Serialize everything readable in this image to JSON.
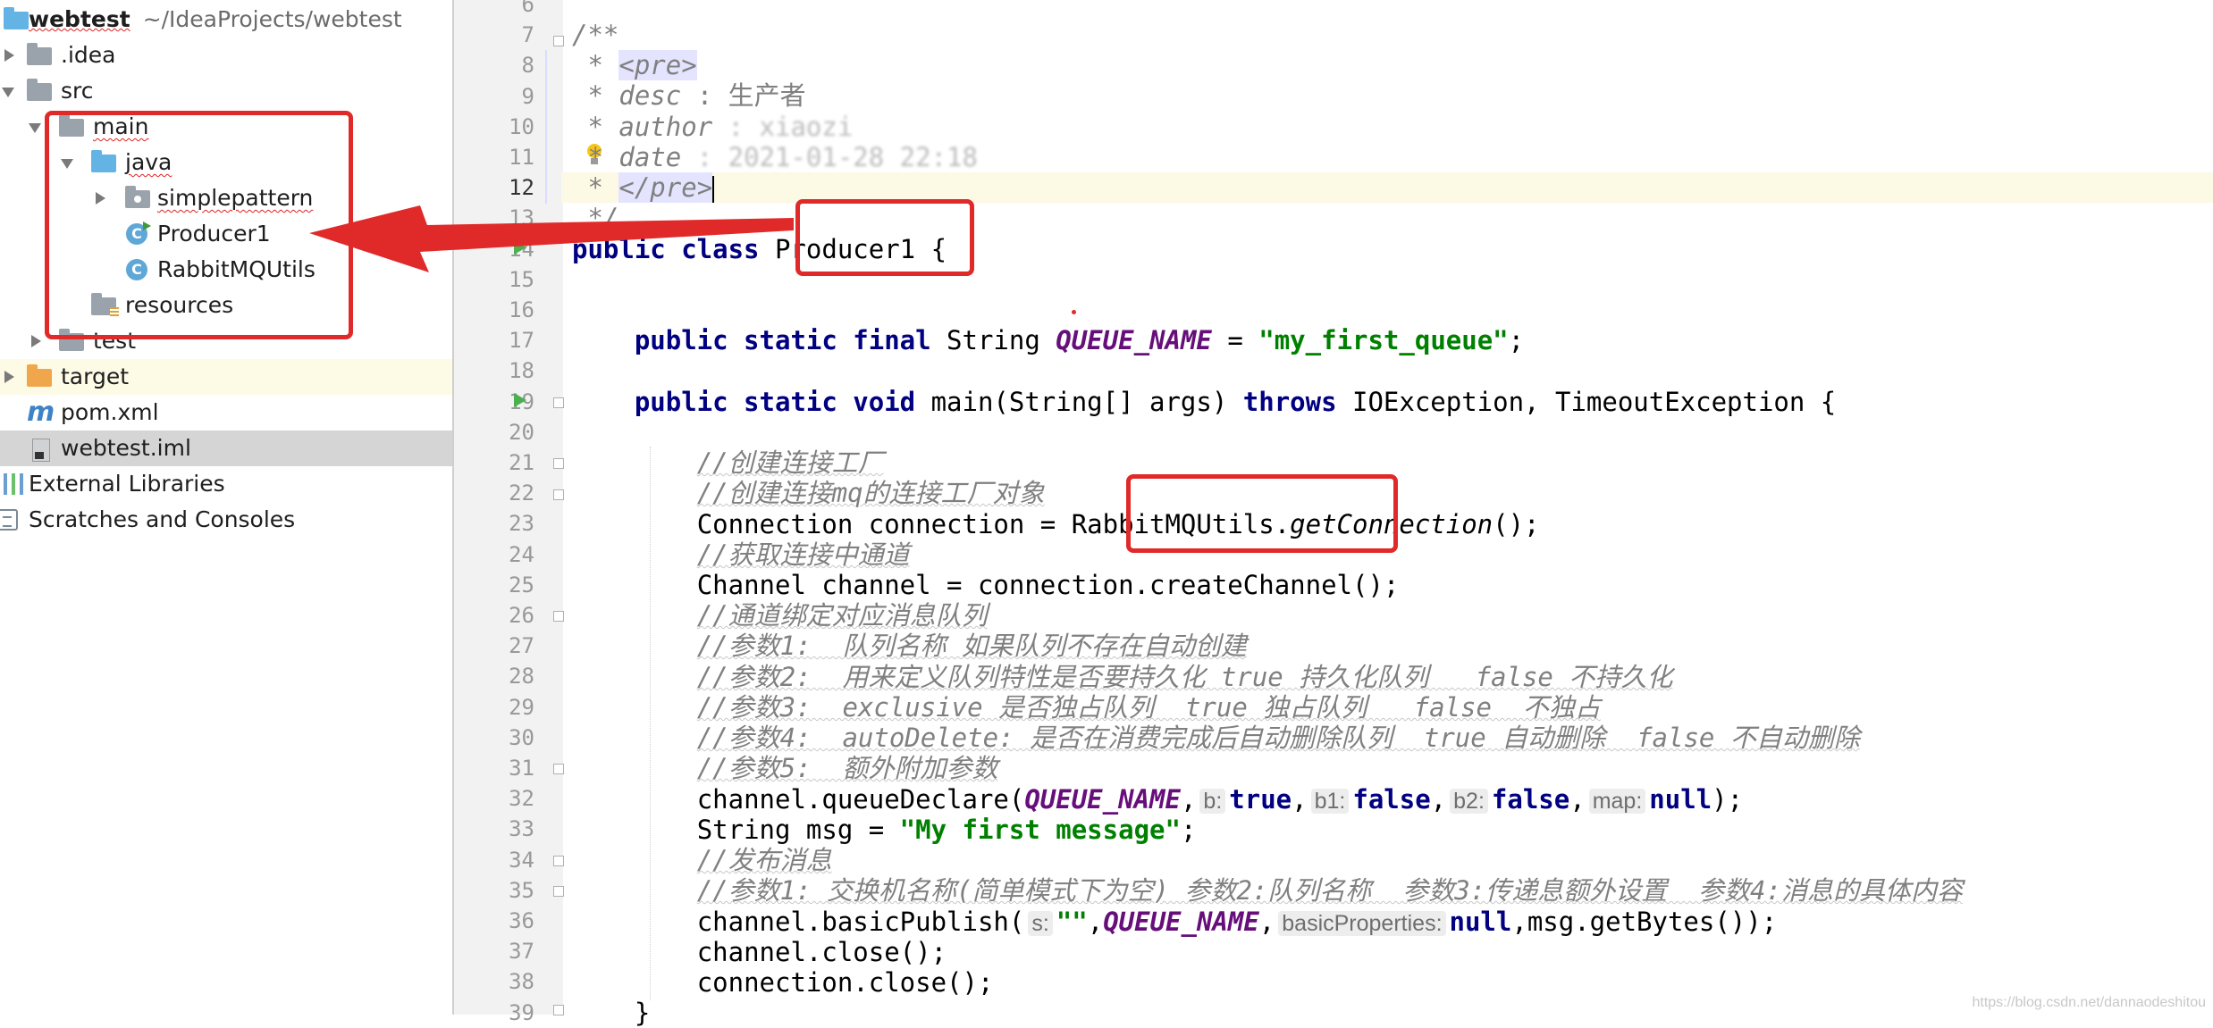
{
  "project_tree": {
    "root_name": "webtest",
    "root_path": "~/IdeaProjects/webtest",
    "items": [
      {
        "label": ".idea",
        "icon": "folder-icon"
      },
      {
        "label": "src",
        "icon": "folder-icon"
      },
      {
        "label": "main",
        "icon": "folder-icon"
      },
      {
        "label": "java",
        "icon": "source-folder-icon"
      },
      {
        "label": "simplepattern",
        "icon": "package-icon"
      },
      {
        "label": "Producer1",
        "icon": "runnable-class-icon"
      },
      {
        "label": "RabbitMQUtils",
        "icon": "class-icon"
      },
      {
        "label": "resources",
        "icon": "resources-folder-icon"
      },
      {
        "label": "test",
        "icon": "folder-icon"
      },
      {
        "label": "target",
        "icon": "excluded-folder-icon"
      },
      {
        "label": "pom.xml",
        "icon": "maven-icon"
      },
      {
        "label": "webtest.iml",
        "icon": "module-file-icon"
      },
      {
        "label": "External Libraries",
        "icon": "libraries-icon"
      },
      {
        "label": "Scratches and Consoles",
        "icon": "scratches-icon"
      }
    ]
  },
  "editor": {
    "line_numbers": [
      "6",
      "7",
      "8",
      "9",
      "10",
      "11",
      "12",
      "13",
      "14",
      "15",
      "16",
      "17",
      "18",
      "19",
      "20",
      "21",
      "22",
      "23",
      "24",
      "25",
      "26",
      "27",
      "28",
      "29",
      "30",
      "31",
      "32",
      "33",
      "34",
      "35",
      "36",
      "37",
      "38",
      "39"
    ],
    "current_line": "12",
    "code": {
      "l7": "/**",
      "l8_star": " * ",
      "l8_tag": "<pre>",
      "l9_star": " * ",
      "l9_key": "desc",
      "l9_val": " : 生产者",
      "l10_star": " * ",
      "l10_key": "author",
      "l10_val": " : xiaozi",
      "l11_star": " * ",
      "l11_key": "date",
      "l11_val": " : 2021-01-28 22:18",
      "l12_star": " * ",
      "l12_tag": "</pre>",
      "l13": " */",
      "l14_kw": "public class",
      "l14_name": " Producer1",
      "l14_rest": " {",
      "l17_kw": "public static final",
      "l17_type": " String ",
      "l17_const": "QUEUE_NAME",
      "l17_eq": " = ",
      "l17_str": "\"my_first_queue\"",
      "l17_end": ";",
      "l19_kw": "public static void",
      "l19_mid": " main(String[] args) ",
      "l19_kw2": "throws",
      "l19_end": " IOException, TimeoutException {",
      "l21": "//创建连接工厂",
      "l22": "//创建连接mq的连接工厂对象",
      "l23_a": "Connection connection = ",
      "l23_b": "RabbitMQUtils.",
      "l23_c": "getConnection",
      "l23_d": "();",
      "l24": "//获取连接中通道",
      "l25": "Channel channel = connection.createChannel();",
      "l26": "//通道绑定对应消息队列",
      "l27": "//参数1:  队列名称 如果队列不存在自动创建",
      "l28": "//参数2:  用来定义队列特性是否要持久化 true 持久化队列   false 不持久化",
      "l29": "//参数3:  exclusive 是否独占队列  true 独占队列   false  不独占",
      "l30": "//参数4:  autoDelete: 是否在消费完成后自动删除队列  true 自动删除  false 不自动删除",
      "l31": "//参数5:  额外附加参数",
      "l32_a": "channel.queueDeclare(",
      "l32_const": "QUEUE_NAME",
      "l32_h1": "b:",
      "l32_v1": "true",
      "l32_h2": "b1:",
      "l32_v2": "false",
      "l32_h3": "b2:",
      "l32_v3": "false",
      "l32_h4": "map:",
      "l32_v4": "null",
      "l32_end": ");",
      "l33_a": "String msg = ",
      "l33_str": "\"My first message\"",
      "l33_end": ";",
      "l34": "//发布消息",
      "l35": "//参数1: 交换机名称(简单模式下为空) 参数2:队列名称  参数3:传递息额外设置  参数4:消息的具体内容",
      "l36_a": "channel.basicPublish(",
      "l36_h1": "s:",
      "l36_str": "\"\"",
      "l36_const": "QUEUE_NAME",
      "l36_h2": "basicProperties:",
      "l36_v2": "null",
      "l36_end": ",msg.getBytes());",
      "l37": "channel.close();",
      "l38": "connection.close();",
      "l39": "}"
    }
  },
  "watermark": "https://blog.csdn.net/dannaodeshitou",
  "colors": {
    "annotation_red": "#e02a2a",
    "keyword": "#000080",
    "string": "#008000",
    "constant": "#660e7a",
    "comment": "#808080"
  }
}
